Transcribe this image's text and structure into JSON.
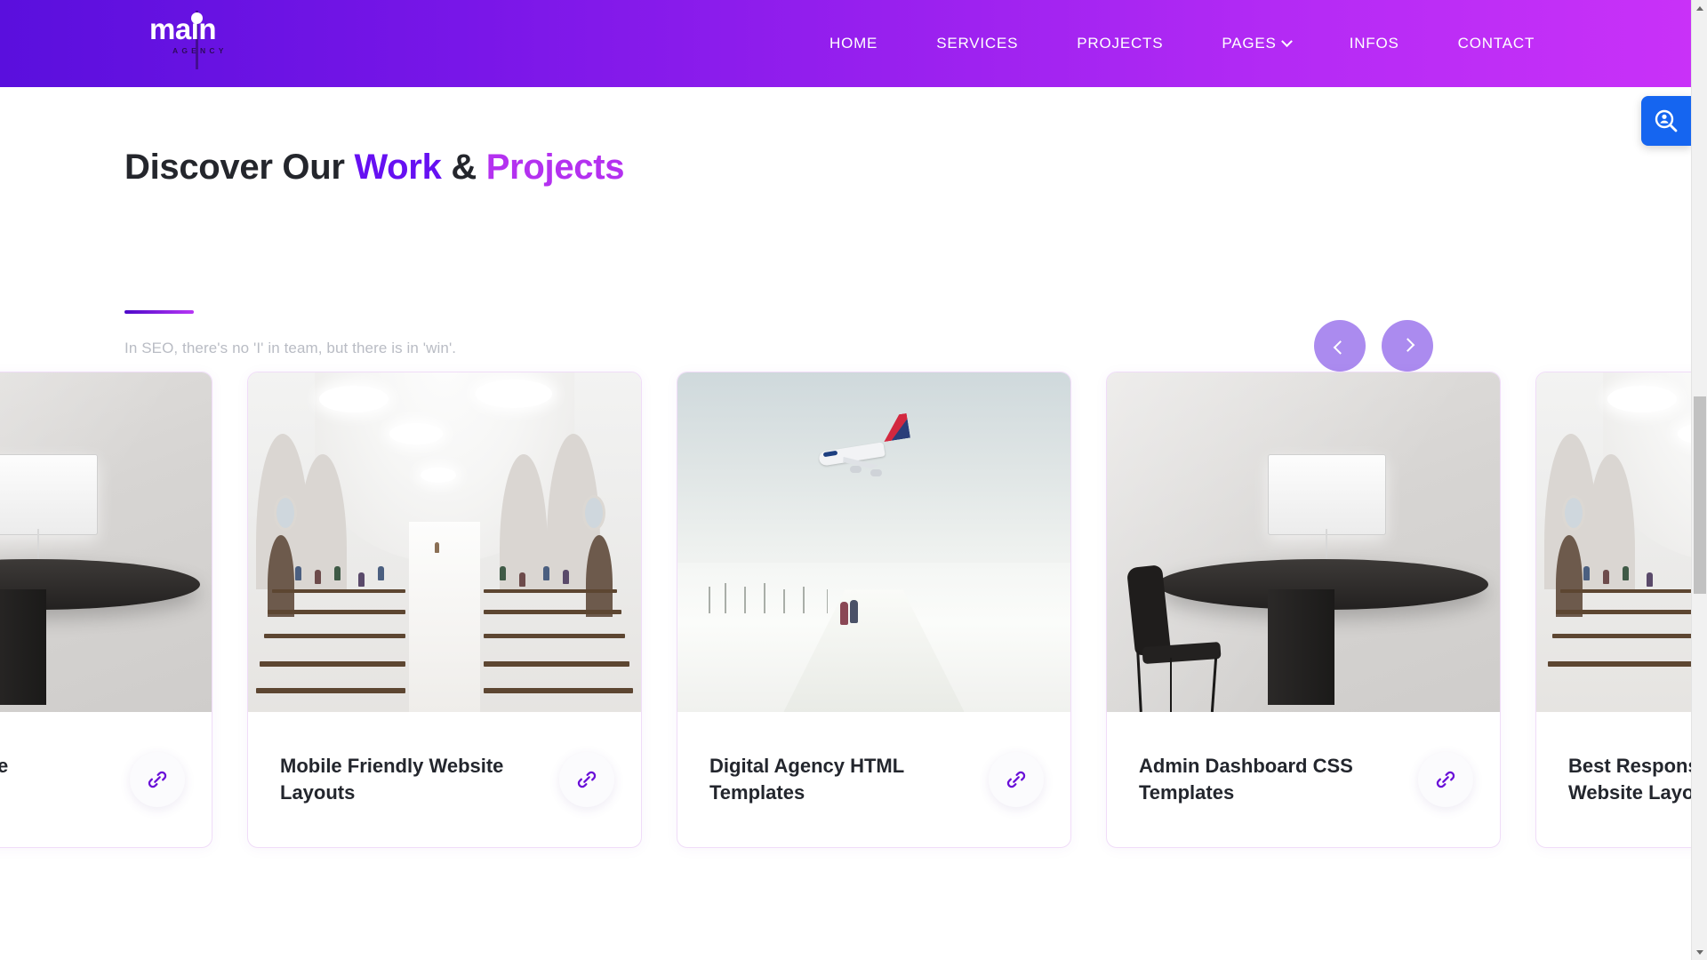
{
  "header": {
    "logo": {
      "word": "main",
      "sub": "AGENCY"
    },
    "nav": [
      {
        "label": "HOME",
        "has_dropdown": false
      },
      {
        "label": "SERVICES",
        "has_dropdown": false
      },
      {
        "label": "PROJECTS",
        "has_dropdown": false
      },
      {
        "label": "PAGES",
        "has_dropdown": true
      },
      {
        "label": "INFOS",
        "has_dropdown": false
      },
      {
        "label": "CONTACT",
        "has_dropdown": false
      }
    ],
    "gradient_from": "#5a0fdd",
    "gradient_to": "#c931f8"
  },
  "widget": {
    "name": "accessibility-search-widget",
    "icon": "person-magnifier-icon",
    "color": "#1565f0"
  },
  "section": {
    "title_part1": "Discover Our ",
    "title_work": "Work",
    "title_amp": " & ",
    "title_projects": "Projects",
    "subtitle": "In SEO, there's no 'I' in team, but there is in 'win'.",
    "accent_work": "#6610f2",
    "accent_projects": "#b431f0",
    "rule_gradient_from": "#4d09c9",
    "rule_gradient_to": "#b836f5",
    "prev_label": "‹",
    "next_label": "›",
    "nav_button_color": "#ab8bef"
  },
  "cards": [
    {
      "title": "Best Responsive Themes",
      "image": "cathedral-interior-photo",
      "link_icon": "chain-link-icon",
      "partial": "left"
    },
    {
      "title": "Mobile Friendly Website Layouts",
      "image": "cathedral-interior-photo",
      "link_icon": "chain-link-icon",
      "partial": "none"
    },
    {
      "title": "Digital Agency HTML Templates",
      "image": "airplane-over-snow-photo",
      "link_icon": "chain-link-icon",
      "partial": "none"
    },
    {
      "title": "Admin Dashboard CSS Templates",
      "image": "desk-chair-lamp-photo",
      "link_icon": "chain-link-icon",
      "partial": "none"
    },
    {
      "title": "Best Responsive Website Layouts",
      "image": "cathedral-interior-photo",
      "link_icon": "chain-link-icon",
      "partial": "right"
    }
  ],
  "scrollbar": {
    "up_icon": "triangle-up-icon",
    "down_icon": "triangle-down-icon",
    "thumb": "scroll-thumb"
  }
}
